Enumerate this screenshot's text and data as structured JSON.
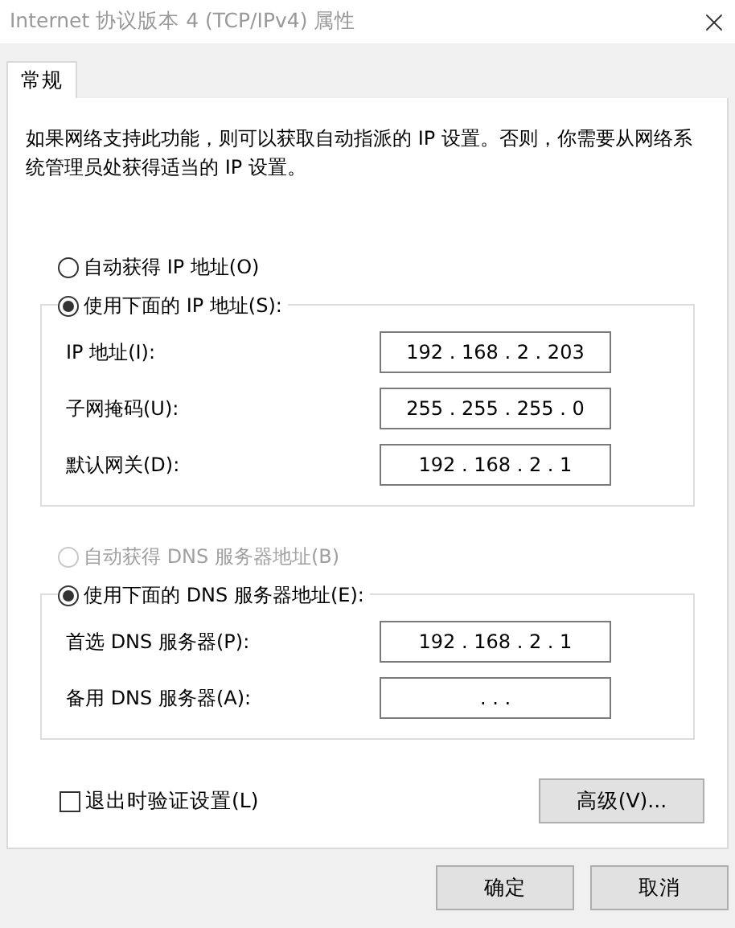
{
  "window": {
    "title": "Internet 协议版本 4 (TCP/IPv4) 属性"
  },
  "tabs": [
    {
      "label": "常规",
      "selected": true
    }
  ],
  "description": "如果网络支持此功能，则可以获取自动指派的 IP 设置。否则，你需要从网络系统管理员处获得适当的 IP 设置。",
  "ip_mode": [
    {
      "label": "自动获得 IP 地址(O)",
      "selected": false,
      "disabled": false
    },
    {
      "label": "使用下面的 IP 地址(S):",
      "selected": true,
      "disabled": false
    }
  ],
  "ip_fields": [
    {
      "label": "IP 地址(I):",
      "value": "192 . 168 . 2 . 203"
    },
    {
      "label": "子网掩码(U):",
      "value": "255 . 255 . 255 . 0"
    },
    {
      "label": "默认网关(D):",
      "value": "192 . 168 . 2 . 1"
    }
  ],
  "dns_mode": [
    {
      "label": "自动获得 DNS 服务器地址(B)",
      "selected": false,
      "disabled": true
    },
    {
      "label": "使用下面的 DNS 服务器地址(E):",
      "selected": true,
      "disabled": false
    }
  ],
  "dns_fields": [
    {
      "label": "首选 DNS 服务器(P):",
      "value": "192 . 168 . 2 . 1"
    },
    {
      "label": "备用 DNS 服务器(A):",
      "value": ". . ."
    }
  ],
  "validate_checkbox": {
    "label": "退出时验证设置(L)",
    "checked": false
  },
  "advanced_button": "高级(V)...",
  "buttons": [
    "确定",
    "取消"
  ]
}
